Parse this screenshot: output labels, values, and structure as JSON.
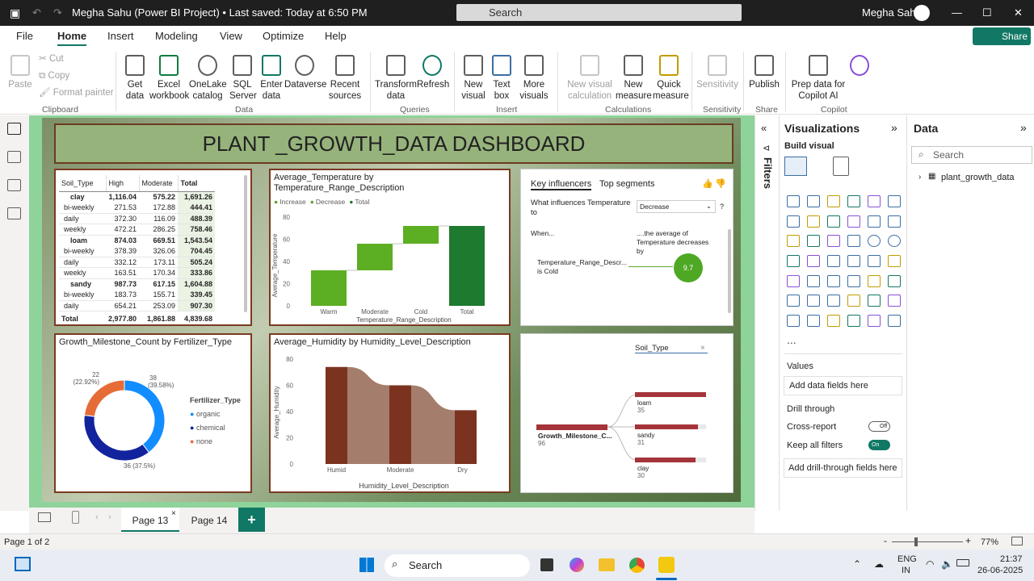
{
  "titlebar": {
    "title": "Megha Sahu (Power BI Project) • Last saved: Today at 6:50 PM",
    "search": "Search",
    "user": "Megha Sahu"
  },
  "ribbon": {
    "tabs": [
      "File",
      "Home",
      "Insert",
      "Modeling",
      "View",
      "Optimize",
      "Help"
    ],
    "share": "Share",
    "clipboard": {
      "paste": "Paste",
      "cut": "Cut",
      "copy": "Copy",
      "format_painter": "Format painter",
      "group": "Clipboard"
    },
    "data": {
      "get_data": "Get data",
      "excel": "Excel workbook",
      "onelake": "OneLake catalog",
      "sql": "SQL Server",
      "enter": "Enter data",
      "dataverse": "Dataverse",
      "recent": "Recent sources",
      "group": "Data"
    },
    "queries": {
      "transform": "Transform data",
      "refresh": "Refresh",
      "group": "Queries"
    },
    "insert": {
      "new_visual": "New visual",
      "text_box": "Text box",
      "more_visuals": "More visuals",
      "group": "Insert"
    },
    "calculations": {
      "new_visual_calc": "New visual calculation",
      "new_measure": "New measure",
      "quick_measure": "Quick measure",
      "group": "Calculations"
    },
    "sensitivity": {
      "label": "Sensitivity",
      "group": "Sensitivity"
    },
    "share_grp": {
      "publish": "Publish",
      "group": "Share"
    },
    "copilot": {
      "prep": "Prep data for Copilot AI",
      "copilot": "Copilot",
      "group": "Copilot"
    }
  },
  "dashboard": {
    "title": "PLANT _GROWTH_DATA DASHBOARD"
  },
  "matrix": {
    "headers": [
      "Soil_Type",
      "High",
      "Moderate",
      "Total"
    ],
    "rows": [
      {
        "label": "clay",
        "high": "1,116.04",
        "moderate": "575.22",
        "total": "1,691.26",
        "level": 0
      },
      {
        "label": "bi-weekly",
        "high": "271.53",
        "moderate": "172.88",
        "total": "444.41",
        "level": 1
      },
      {
        "label": "daily",
        "high": "372.30",
        "moderate": "116.09",
        "total": "488.39",
        "level": 1
      },
      {
        "label": "weekly",
        "high": "472.21",
        "moderate": "286.25",
        "total": "758.46",
        "level": 1
      },
      {
        "label": "loam",
        "high": "874.03",
        "moderate": "669.51",
        "total": "1,543.54",
        "level": 0
      },
      {
        "label": "bi-weekly",
        "high": "378.39",
        "moderate": "326.06",
        "total": "704.45",
        "level": 1
      },
      {
        "label": "daily",
        "high": "332.12",
        "moderate": "173.11",
        "total": "505.24",
        "level": 1
      },
      {
        "label": "weekly",
        "high": "163.51",
        "moderate": "170.34",
        "total": "333.86",
        "level": 1
      },
      {
        "label": "sandy",
        "high": "987.73",
        "moderate": "617.15",
        "total": "1,604.88",
        "level": 0
      },
      {
        "label": "bi-weekly",
        "high": "183.73",
        "moderate": "155.71",
        "total": "339.45",
        "level": 1
      },
      {
        "label": "daily",
        "high": "654.21",
        "moderate": "253.09",
        "total": "907.30",
        "level": 1
      }
    ],
    "total": {
      "label": "Total",
      "high": "2,977.80",
      "moderate": "1,861.88",
      "total": "4,839.68"
    }
  },
  "chart_data": [
    {
      "type": "waterfall",
      "title": "Average_Temperature by Temperature_Range_Description",
      "xlabel": "Temperature_Range_Description",
      "ylabel": "Average_Temperature",
      "legend": [
        "Increase",
        "Decrease",
        "Total"
      ],
      "categories": [
        "Warm",
        "Moderate",
        "Cold",
        "Total"
      ],
      "start": [
        0,
        32,
        56,
        0
      ],
      "end": [
        32,
        56,
        72,
        72
      ],
      "ylim": [
        0,
        80
      ],
      "yticks": [
        0,
        20,
        40,
        60,
        80
      ]
    },
    {
      "type": "pie",
      "title": "Growth_Milestone_Count by Fertilizer_Type",
      "legend_title": "Fertilizer_Type",
      "slices": [
        {
          "name": "organic",
          "value": 38,
          "label": "38 (39.58%)",
          "color": "#118dff"
        },
        {
          "name": "chemical",
          "value": 36,
          "label": "36 (37.5%)",
          "color": "#12239e"
        },
        {
          "name": "none",
          "value": 22,
          "label": "22 (22.92%)",
          "color": "#e66c37"
        }
      ]
    },
    {
      "type": "area",
      "title": "Average_Humidity by Humidity_Level_Description",
      "xlabel": "Humidity_Level_Description",
      "ylabel": "Average_Humidity",
      "categories": [
        "Humid",
        "Moderate",
        "Dry"
      ],
      "ylim": [
        0,
        80
      ],
      "yticks": [
        0,
        20,
        40,
        60,
        80
      ],
      "values": [
        74,
        60,
        41
      ]
    }
  ],
  "influencers": {
    "tab1": "Key influencers",
    "tab2": "Top segments",
    "question": "What influences Temperature to",
    "dropdown": "Decrease",
    "when": "When...",
    "then": "....the average of Temperature decreases by",
    "factor": "Temperature_Range_Descr... is Cold",
    "value": "9.7"
  },
  "decomp": {
    "header": "Soil_Type",
    "root_label": "Growth_Milestone_C...",
    "root_value": "96",
    "items": [
      {
        "name": "loam",
        "value": "35"
      },
      {
        "name": "sandy",
        "value": "31"
      },
      {
        "name": "clay",
        "value": "30"
      }
    ]
  },
  "filters": {
    "label": "Filters"
  },
  "viz": {
    "title": "Visualizations",
    "build": "Build visual",
    "values": "Values",
    "add_data": "Add data fields here",
    "drill": "Drill through",
    "cross": "Cross-report",
    "cross_state": "Off",
    "keep": "Keep all filters",
    "keep_state": "On",
    "add_drill": "Add drill-through fields here",
    "more": "..."
  },
  "datapane": {
    "title": "Data",
    "search": "Search",
    "table": "plant_growth_data"
  },
  "pages": {
    "tab1": "Page 13",
    "tab2": "Page 14",
    "add": "+"
  },
  "status": {
    "page": "Page 1 of 2",
    "zoom": "77%"
  },
  "taskbar": {
    "search": "Search",
    "lang1": "ENG",
    "lang2": "IN",
    "time": "21:37",
    "date": "26-06-2025"
  }
}
